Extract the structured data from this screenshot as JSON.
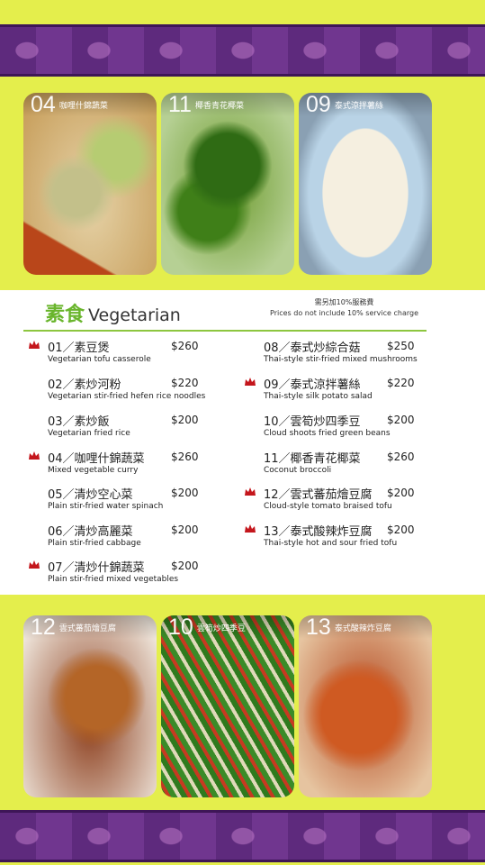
{
  "top_photos": [
    {
      "num": "04",
      "name": "咖哩什錦蔬菜"
    },
    {
      "num": "11",
      "name": "椰香青花椰菜"
    },
    {
      "num": "09",
      "name": "泰式涼拌薯絲"
    }
  ],
  "section": {
    "title_zh": "素食",
    "title_en": "Vegetarian",
    "service_zh": "需另加10%服務費",
    "service_en": "Prices do not include 10% service charge"
  },
  "left_items": [
    {
      "label": "01／素豆煲",
      "price": "$260",
      "en": "Vegetarian tofu casserole",
      "crown": true
    },
    {
      "label": "02／素炒河粉",
      "price": "$220",
      "en": "Vegetarian stir-fried hefen rice noodles",
      "crown": false
    },
    {
      "label": "03／素炒飯",
      "price": "$200",
      "en": "Vegetarian fried rice",
      "crown": false
    },
    {
      "label": "04／咖哩什錦蔬菜",
      "price": "$260",
      "en": "Mixed vegetable curry",
      "crown": true
    },
    {
      "label": "05／清炒空心菜",
      "price": "$200",
      "en": "Plain stir-fried water spinach",
      "crown": false
    },
    {
      "label": "06／清炒高麗菜",
      "price": "$200",
      "en": "Plain stir-fried cabbage",
      "crown": false
    },
    {
      "label": "07／清炒什錦蔬菜",
      "price": "$200",
      "en": "Plain stir-fried mixed vegetables",
      "crown": true
    }
  ],
  "right_items": [
    {
      "label": "08／泰式炒綜合菇",
      "price": "$250",
      "en": "Thai-style stir-fried mixed mushrooms",
      "crown": false
    },
    {
      "label": "09／泰式涼拌薯絲",
      "price": "$220",
      "en": "Thai-style silk potato salad",
      "crown": true
    },
    {
      "label": "10／雲筍炒四季豆",
      "price": "$200",
      "en": "Cloud shoots fried green beans",
      "crown": false
    },
    {
      "label": "11／椰香青花椰菜",
      "price": "$260",
      "en": "Coconut broccoli",
      "crown": false
    },
    {
      "label": "12／雲式蕃茄燴豆腐",
      "price": "$200",
      "en": "Cloud-style tomato braised tofu",
      "crown": true
    },
    {
      "label": "13／泰式酸辣炸豆腐",
      "price": "$200",
      "en": "Thai-style hot and sour fried tofu",
      "crown": true
    }
  ],
  "bottom_photos": [
    {
      "num": "12",
      "name": "雲式蕃茄燴豆腐"
    },
    {
      "num": "10",
      "name": "雲筍炒四季豆"
    },
    {
      "num": "13",
      "name": "泰式酸辣炸豆腐"
    }
  ],
  "colors": {
    "background": "#e4ee4c",
    "accent_green": "#69b52c",
    "band_purple": "#5e2a7d",
    "crown_red": "#c4161c"
  }
}
